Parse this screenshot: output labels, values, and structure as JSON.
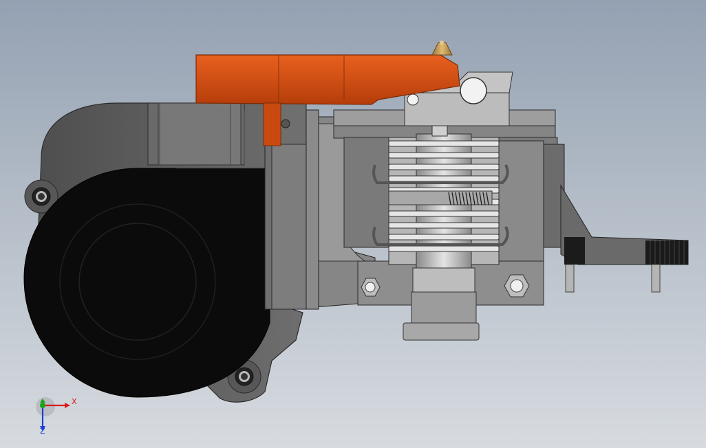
{
  "viewport": {
    "background_top": "#94a1b2",
    "background_bottom": "#d7dbe0"
  },
  "model": {
    "parts": [
      {
        "name": "blower-fan",
        "color": "#0c0c0c"
      },
      {
        "name": "fan-duct",
        "color": "#5f5f5f"
      },
      {
        "name": "extruder-lever",
        "color": "#d24a0f"
      },
      {
        "name": "carriage-plate",
        "color": "#7b7b7b"
      },
      {
        "name": "heatsink",
        "color": "#c9c9c9"
      },
      {
        "name": "heat-break-spring",
        "color": "#333333"
      },
      {
        "name": "nozzle-tip",
        "color": "#c89a52"
      },
      {
        "name": "mount-bracket",
        "color": "#6a6a6a"
      }
    ]
  },
  "triad": {
    "x_label": "X",
    "z_label": "Z",
    "x_color": "#d81c1c",
    "z_color": "#1c3fd8",
    "y_color": "#1aa31a"
  }
}
